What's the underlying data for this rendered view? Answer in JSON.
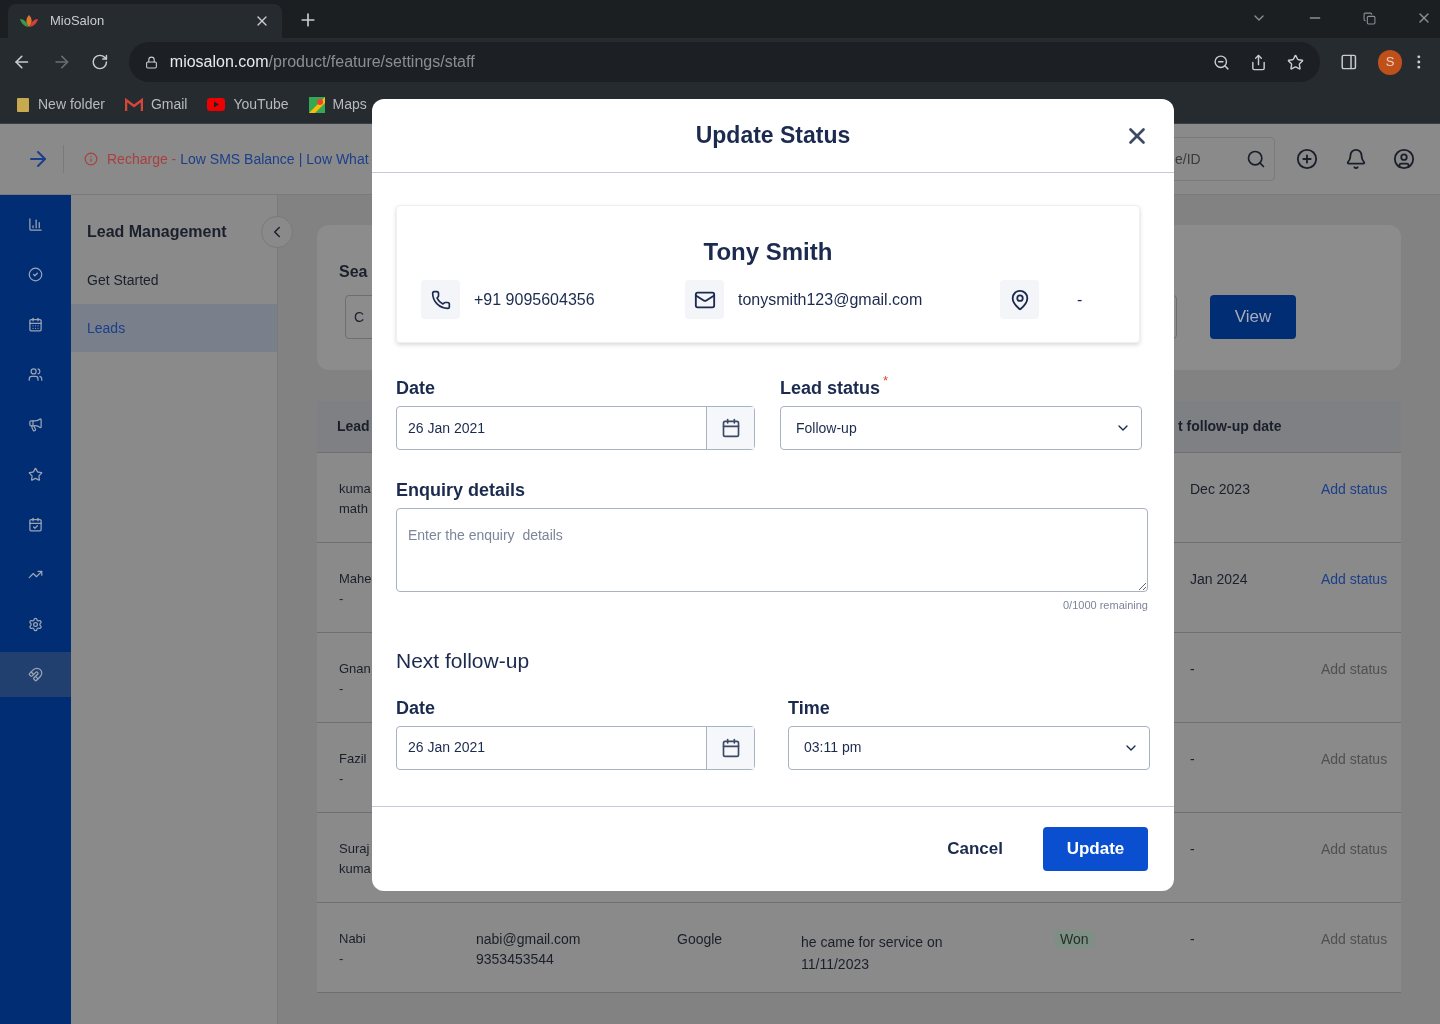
{
  "browser": {
    "tab_title": "MioSalon",
    "url_host": "miosalon.com",
    "url_path": "/product/feature/settings/staff",
    "profile_initial": "S",
    "bookmarks": [
      {
        "label": "New folder",
        "kind": "folder"
      },
      {
        "label": "Gmail",
        "kind": "mail"
      },
      {
        "label": "YouTube",
        "kind": "video"
      },
      {
        "label": "Maps",
        "kind": "map"
      }
    ]
  },
  "header": {
    "alert_parts": [
      {
        "text": "Recharge -",
        "kind": "label"
      },
      {
        "text": "Low SMS Balance",
        "kind": "link"
      },
      {
        "text": "|",
        "kind": "separator"
      },
      {
        "text": "Low What",
        "kind": "link"
      }
    ],
    "search_placeholder": "e/ID"
  },
  "rail": [
    {
      "selected": false
    },
    {
      "selected": false
    },
    {
      "selected": false
    },
    {
      "selected": false
    },
    {
      "selected": false
    },
    {
      "selected": false
    },
    {
      "selected": false
    },
    {
      "selected": false
    },
    {
      "selected": false
    },
    {
      "selected": true
    }
  ],
  "sidebar": {
    "title": "Lead Management",
    "items": [
      {
        "label": "Get Started",
        "selected": false
      },
      {
        "label": "Leads",
        "selected": true
      }
    ]
  },
  "search_card": {
    "title": "Sea",
    "select_value": "C",
    "button": "View"
  },
  "table": {
    "lead_header": "Lead",
    "follow_up_header": "t follow-up date",
    "rows": [
      {
        "lead": [
          "kuma",
          "math"
        ],
        "follow_up": "Dec 2023",
        "action": "Add status",
        "action_enabled": true
      },
      {
        "lead": [
          "Mahe",
          "-"
        ],
        "follow_up": "Jan 2024",
        "action": "Add status",
        "action_enabled": true
      },
      {
        "lead": [
          "Gnan",
          "-"
        ],
        "follow_up": "-",
        "action": "Add status",
        "action_enabled": false
      },
      {
        "lead": [
          "Fazil",
          "-"
        ],
        "follow_up": "-",
        "action": "Add status",
        "action_enabled": false
      },
      {
        "lead": [
          "Suraj",
          "kuma"
        ],
        "follow_up": "-",
        "action": "Add status",
        "action_enabled": false
      },
      {
        "lead": [
          "Nabi",
          "-"
        ],
        "email": "nabi@gmail.com",
        "phone": "9353453544",
        "source": "Google",
        "enquiry": "he came for service on 11/11/2023",
        "status": "Won",
        "follow_up": "-",
        "action": "Add status",
        "action_enabled": false
      }
    ]
  },
  "modal": {
    "title": "Update Status",
    "contact": {
      "name": "Tony Smith",
      "phone": "+91 9095604356",
      "email": "tonysmith123@gmail.com",
      "location": "-"
    },
    "date_label": "Date",
    "date_value": "26 Jan 2021",
    "status_label": "Lead status",
    "required_mark": "*",
    "status_value": "Follow-up",
    "enquiry_label": "Enquiry details",
    "enquiry_placeholder": "Enter the enquiry  details",
    "counter": "0/1000 remaining",
    "next_title": "Next follow-up",
    "next_date_label": "Date",
    "next_date_value": "26 Jan 2021",
    "time_label": "Time",
    "time_value": "03:11 pm",
    "cancel": "Cancel",
    "update": "Update"
  }
}
